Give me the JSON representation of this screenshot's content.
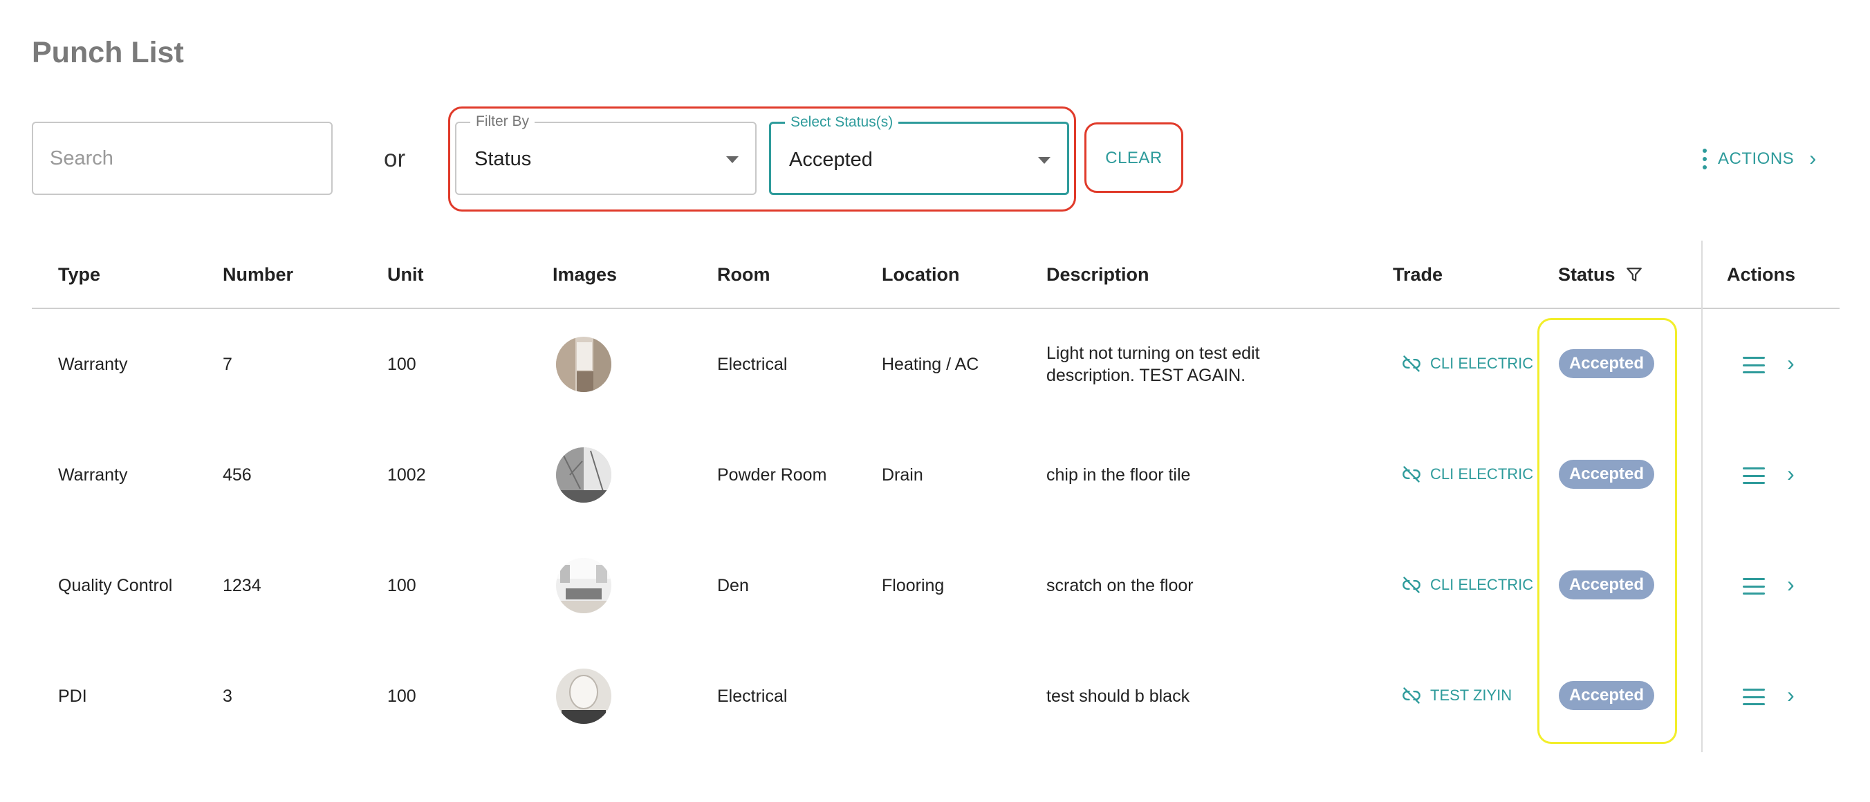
{
  "page": {
    "title": "Punch List"
  },
  "search": {
    "placeholder": "Search"
  },
  "or_label": "or",
  "filter_by": {
    "label": "Filter By",
    "value": "Status"
  },
  "status_select": {
    "label": "Select Status(s)",
    "value": "Accepted"
  },
  "clear_label": "CLEAR",
  "actions_label": "ACTIONS",
  "columns": [
    "Type",
    "Number",
    "Unit",
    "Images",
    "Room",
    "Location",
    "Description",
    "Trade",
    "Status",
    "Actions"
  ],
  "rows": [
    {
      "type": "Warranty",
      "number": "7",
      "unit": "100",
      "image": "bathroom-photo",
      "room": "Electrical",
      "location": "Heating / AC",
      "description": [
        "Light not turning on test edit",
        "description. TEST AGAIN."
      ],
      "trade": "CLI ELECTRIC",
      "status": "Accepted"
    },
    {
      "type": "Warranty",
      "number": "456",
      "unit": "1002",
      "image": "marble-shower-photo",
      "room": "Powder Room",
      "location": "Drain",
      "description": [
        "chip in the floor tile"
      ],
      "trade": "CLI ELECTRIC",
      "status": "Accepted"
    },
    {
      "type": "Quality Control",
      "number": "1234",
      "unit": "100",
      "image": "living-room-photo",
      "room": "Den",
      "location": "Flooring",
      "description": [
        "scratch on the floor"
      ],
      "trade": "CLI ELECTRIC",
      "status": "Accepted"
    },
    {
      "type": "PDI",
      "number": "3",
      "unit": "100",
      "image": "vanity-photo",
      "room": "Electrical",
      "location": "",
      "description": [
        "test should b black"
      ],
      "trade": "TEST ZIYIN",
      "status": "Accepted"
    }
  ],
  "colors": {
    "accent": "#2e9b9b",
    "badge": "#8da3c6",
    "highlight_red": "#e03a2a",
    "highlight_yellow": "#f2ee2a"
  }
}
